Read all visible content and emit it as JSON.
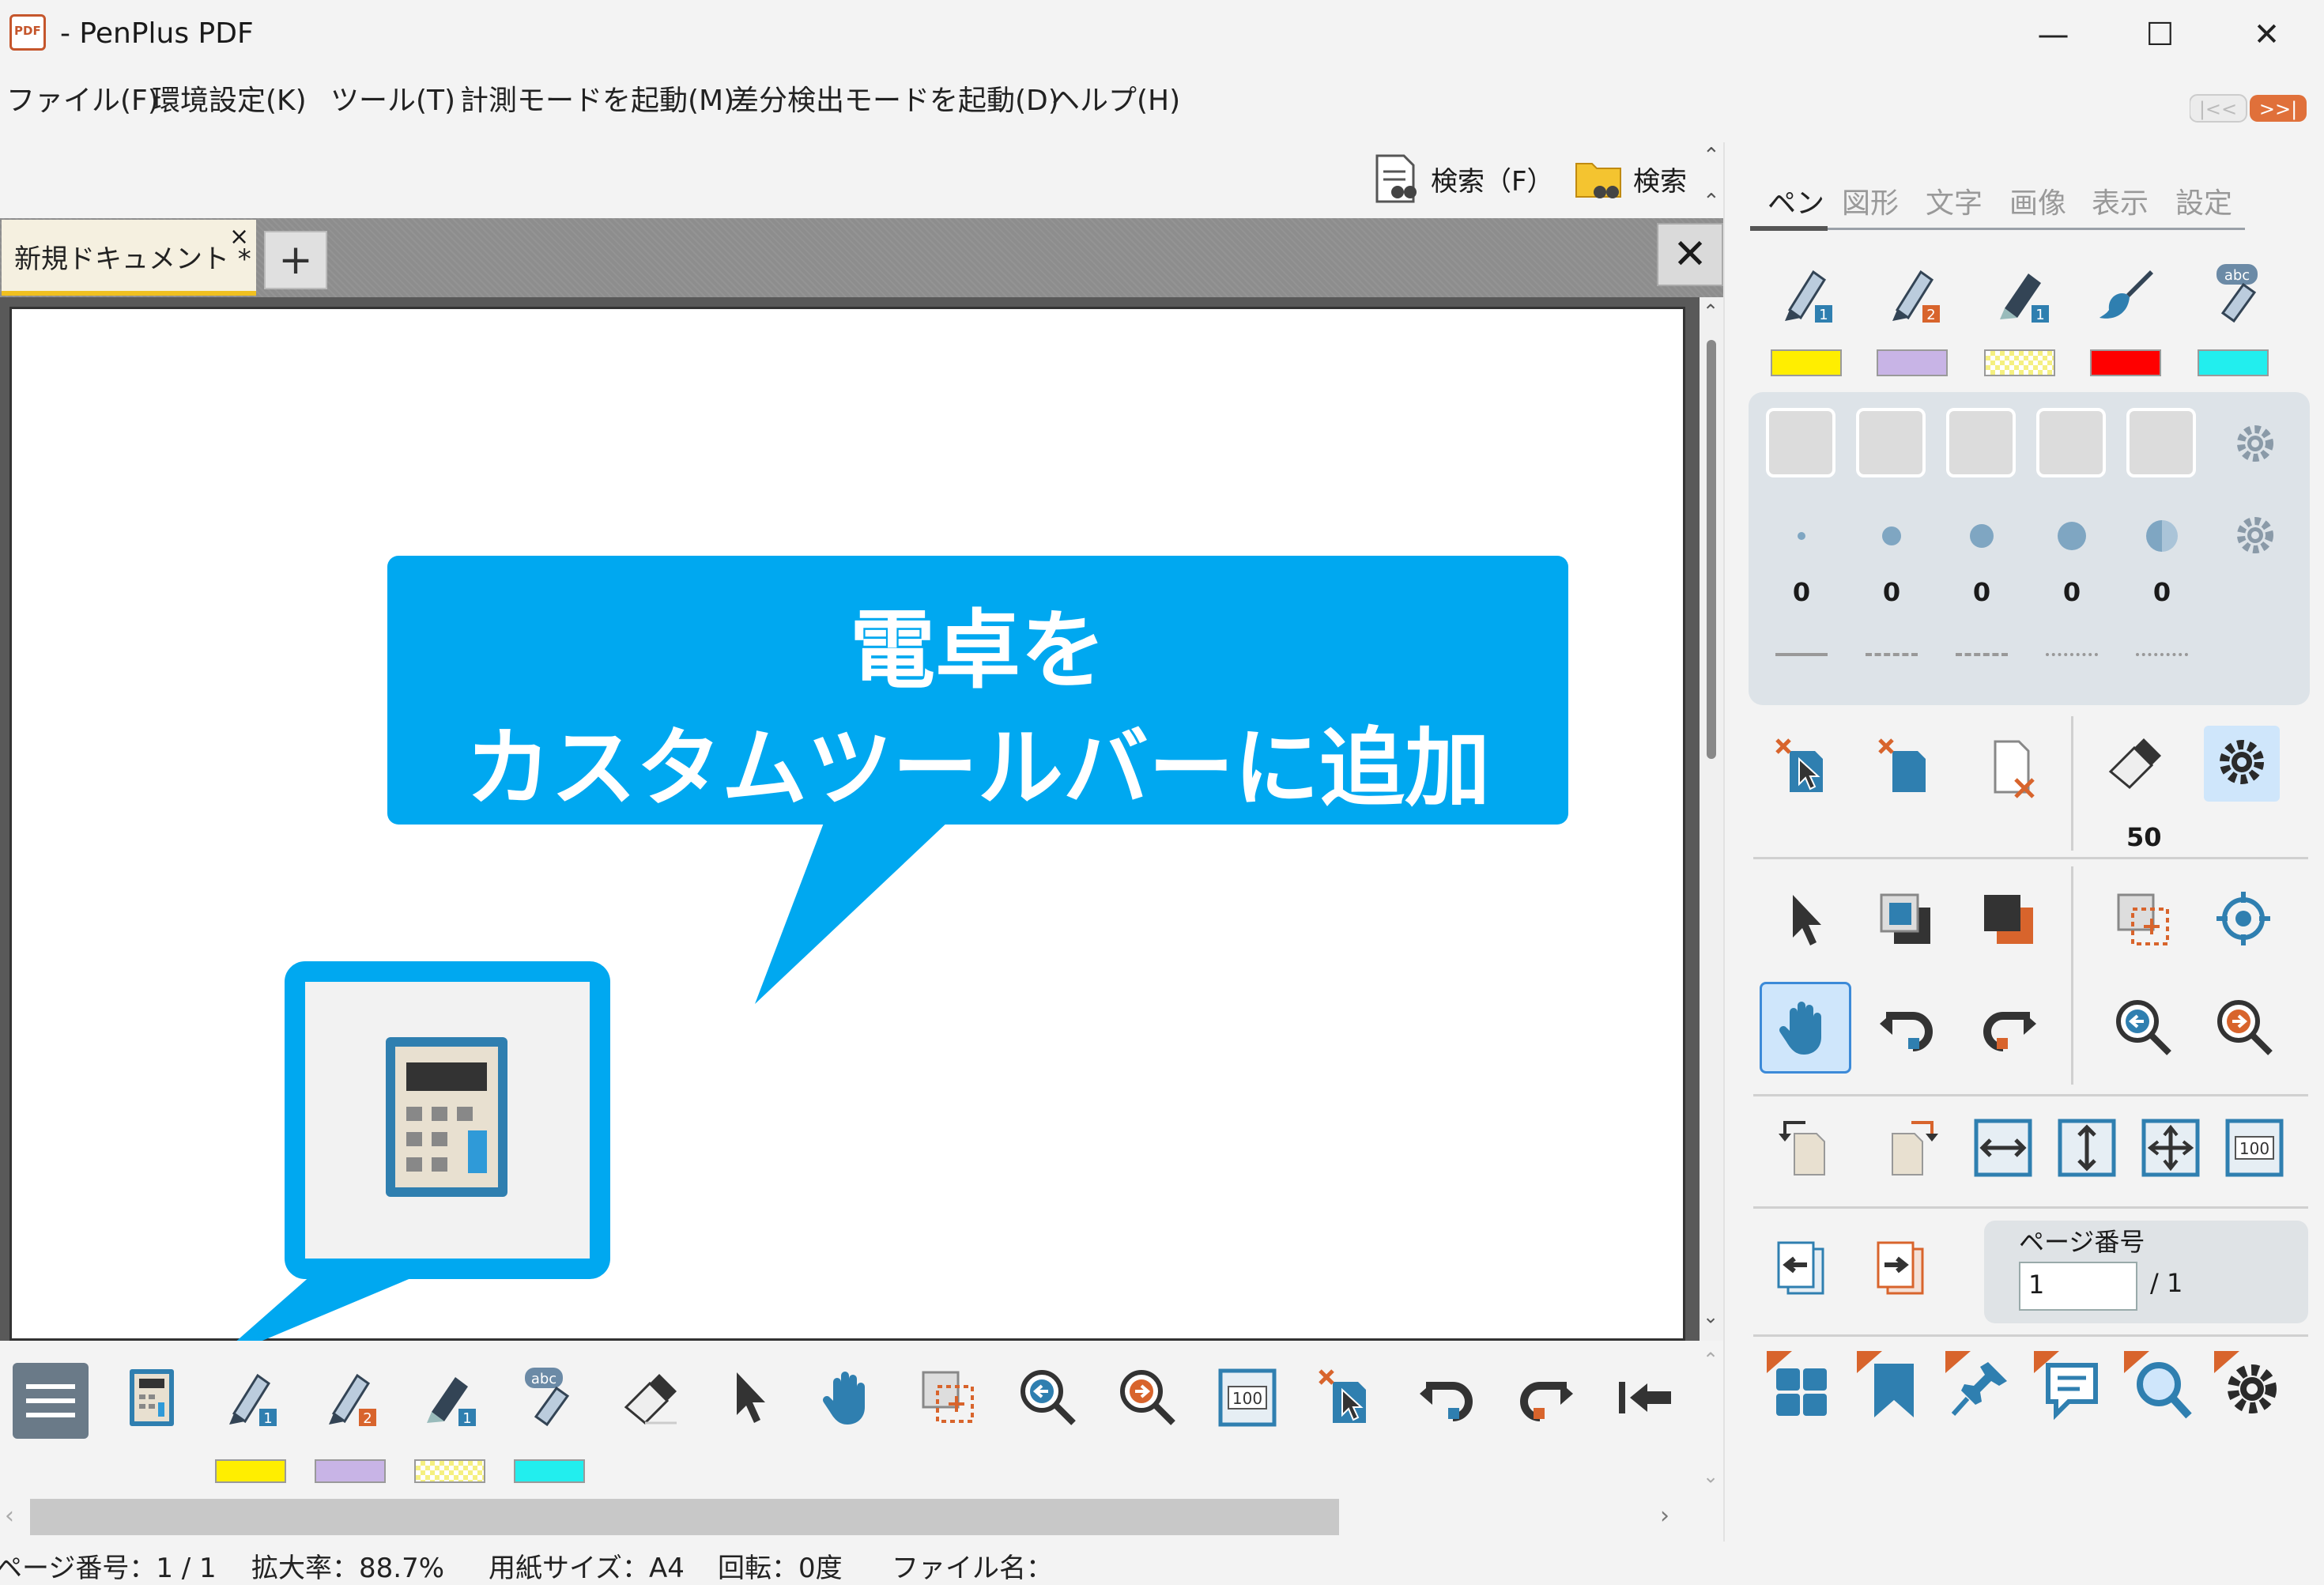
{
  "window": {
    "title": "- PenPlus PDF",
    "app_icon_text": "PDF",
    "minimize": "—",
    "maximize": "☐",
    "close": "✕"
  },
  "menu": {
    "items": [
      "ファイル(F)",
      "環境設定(K)",
      "ツール(T)",
      "計測モードを起動(M)",
      "差分検出モードを起動(D)",
      "ヘルプ(H)"
    ]
  },
  "search": {
    "search_label": "検索（F）",
    "folder_search_label": "検索"
  },
  "tabs": {
    "document_tab": "新規ドキュメント *",
    "tab_close": "×",
    "new_tab": "+",
    "close_document": "✕"
  },
  "callout": {
    "line1": "電卓を",
    "line2": "カスタムツールバーに追加"
  },
  "bottom_toolbar": {
    "swatch_colors": [
      "#ffee00",
      "#c8b4e6",
      "#f5f080",
      "#22eeee"
    ]
  },
  "status": {
    "page": "ページ番号：1 / 1",
    "zoom": "拡大率：88.7%",
    "paper": "用紙サイズ：A4",
    "rotation": "回転：0度",
    "filename": "ファイル名："
  },
  "right_panel": {
    "tabs": [
      "ペン",
      "図形",
      "文字",
      "画像",
      "表示",
      "設定"
    ],
    "pen_colors": [
      "#ffee00",
      "#c8b4e6",
      "#f5f080",
      "#ff0000",
      "#22eeee"
    ],
    "widths": [
      "0",
      "0",
      "0",
      "0",
      "0"
    ],
    "pen_size": "50",
    "page_number_title": "ページ番号",
    "page_number_value": "1",
    "page_number_total": "/ 1"
  }
}
